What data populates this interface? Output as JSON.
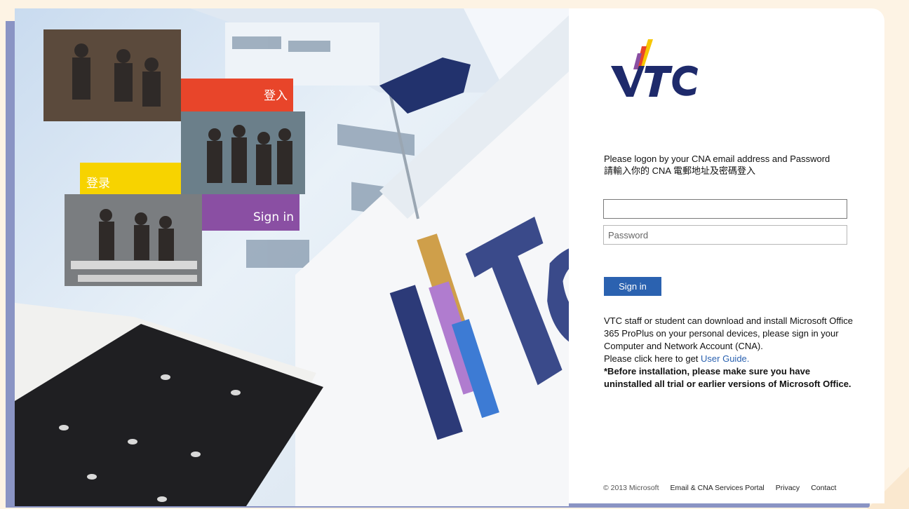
{
  "brand": {
    "logo_text": "VTC",
    "accent_colors": [
      "#1e2a6b",
      "#e8452a",
      "#f7c600",
      "#8a4fa3",
      "#2b62b0"
    ]
  },
  "hero": {
    "tile_labels": {
      "traditional": "登入",
      "simplified": "登录",
      "english": "Sign in"
    },
    "tile_colors": {
      "red": "#e8452a",
      "yellow": "#f7d300",
      "purple": "#8a4fa3"
    }
  },
  "login": {
    "instruction_en": "Please logon by your CNA email address and Password",
    "instruction_zh": "請輸入你的 CNA 電郵地址及密碼登入",
    "username_value": "",
    "username_placeholder": "",
    "password_placeholder": "Password",
    "signin_label": "Sign in"
  },
  "info": {
    "para1": "VTC staff or student can download and install Microsoft Office 365 ProPlus on your personal devices, please sign in your Computer and Network Account (CNA).",
    "guide_prefix": "Please click here to get ",
    "guide_link": "User Guide.",
    "warning": "*Before installation, please make sure you have uninstalled all trial or earlier versions of Microsoft Office."
  },
  "footer": {
    "copyright": "© 2013 Microsoft",
    "links": [
      "Email & CNA Services Portal",
      "Privacy",
      "Contact"
    ]
  }
}
